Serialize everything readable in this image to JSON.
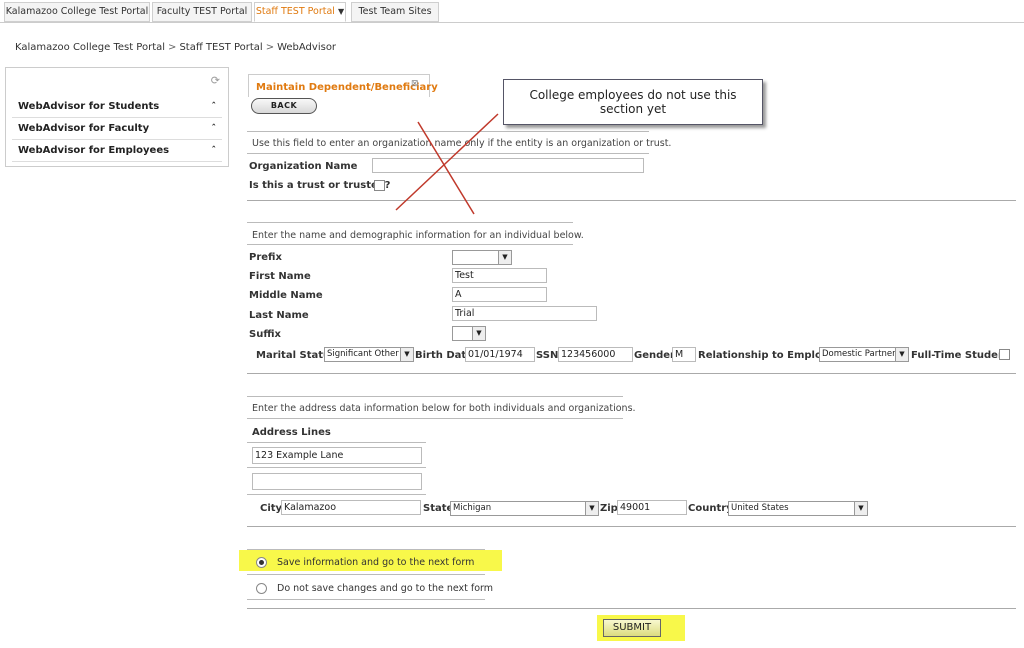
{
  "tabs": [
    {
      "label": "Kalamazoo College Test Portal"
    },
    {
      "label": "Faculty TEST Portal"
    },
    {
      "label": "Staff TEST Portal"
    },
    {
      "label": "Test Team Sites"
    }
  ],
  "breadcrumb": [
    "Kalamazoo College Test Portal",
    "Staff TEST Portal",
    "WebAdvisor"
  ],
  "sidebar": {
    "items": [
      {
        "label": "WebAdvisor for Students"
      },
      {
        "label": "WebAdvisor for Faculty"
      },
      {
        "label": "WebAdvisor for Employees"
      }
    ]
  },
  "form": {
    "title": "Maintain Dependent/Beneficiary",
    "back_label": "BACK",
    "callout": "College employees do not use this section yet",
    "org_note": "Use this field to enter an organization name only if the entity is an organization or trust.",
    "org_name_label": "Organization Name",
    "org_name_value": "",
    "trust_label": "Is this a trust or trustee?",
    "indiv_note": "Enter the name and demographic information for an individual below.",
    "prefix_label": "Prefix",
    "prefix_value": "",
    "first_name_label": "First Name",
    "first_name_value": "Test",
    "middle_name_label": "Middle Name",
    "middle_name_value": "A",
    "last_name_label": "Last Name",
    "last_name_value": "Trial",
    "suffix_label": "Suffix",
    "suffix_value": "",
    "marital_label": "Marital Status",
    "marital_value": "Significant Other",
    "birth_label": "Birth Date",
    "birth_value": "01/01/1974",
    "ssn_label": "SSN",
    "ssn_value": "123456000",
    "gender_label": "Gender",
    "gender_value": "M",
    "relationship_label": "Relationship to Employee",
    "relationship_value": "Domestic Partner",
    "fulltime_label": "Full-Time Student",
    "address_note": "Enter the address data information below for both individuals and organizations.",
    "address_lines_label": "Address Lines",
    "address_line1": "123 Example Lane",
    "address_line2": "",
    "city_label": "City",
    "city_value": "Kalamazoo",
    "state_label": "State",
    "state_value": "Michigan",
    "zip_label": "Zip",
    "zip_value": "49001",
    "country_label": "Country",
    "country_value": "United States",
    "option_save": "Save information and go to the next form",
    "option_nosave": "Do not save changes and go to the next form",
    "submit_label": "SUBMIT"
  },
  "colors": {
    "accent": "#e07a10",
    "highlight": "#f8f84a"
  }
}
